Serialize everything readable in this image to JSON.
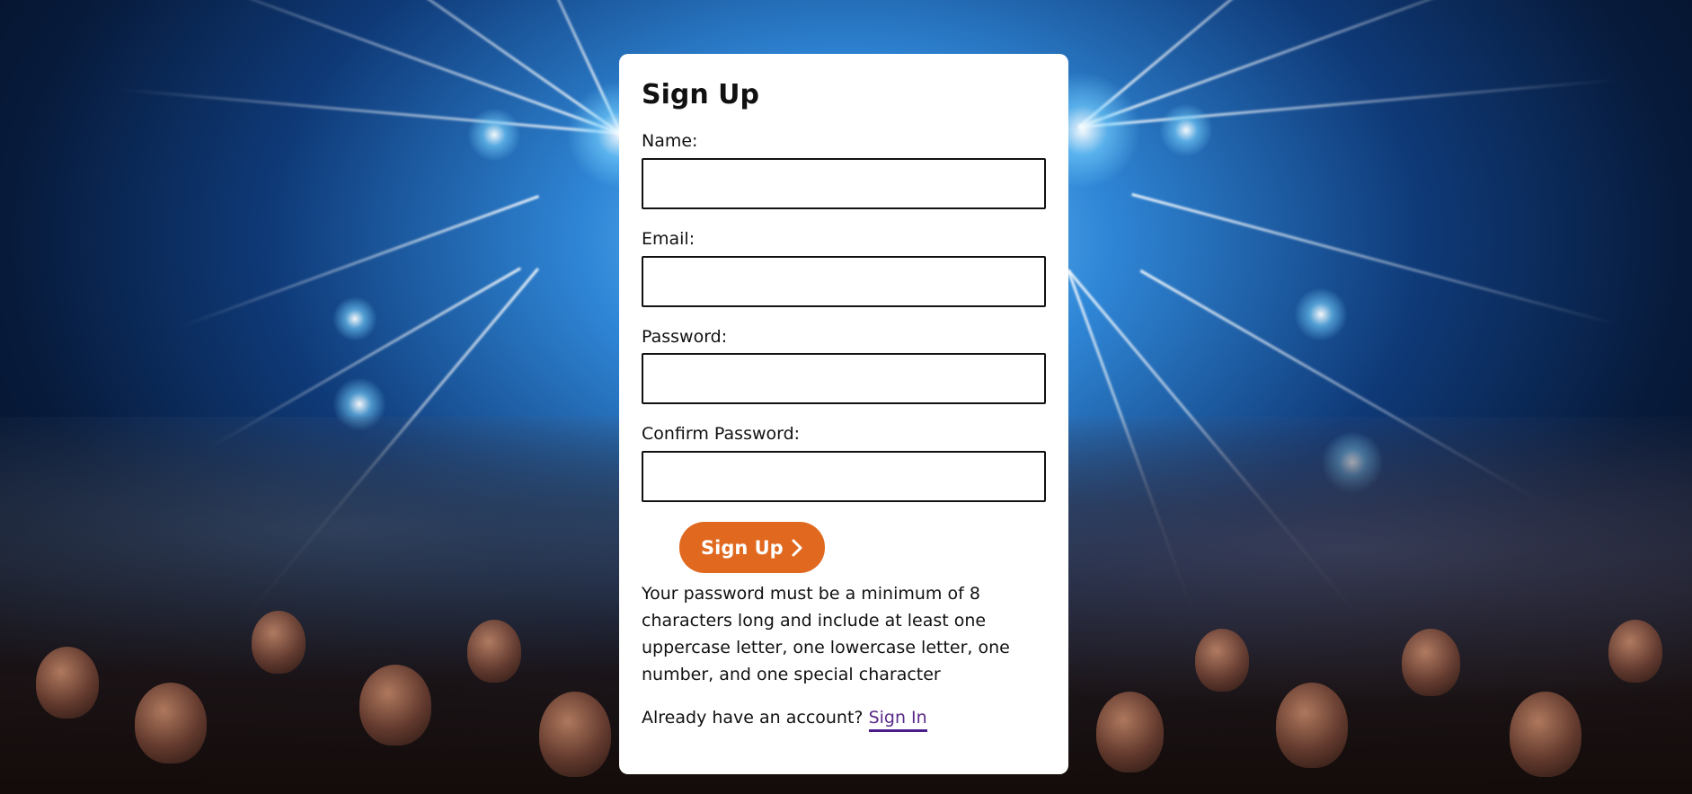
{
  "form": {
    "title": "Sign Up",
    "fields": [
      {
        "label": "Name:",
        "value": "",
        "placeholder": ""
      },
      {
        "label": "Email:",
        "value": "",
        "placeholder": ""
      },
      {
        "label": "Password:",
        "value": "",
        "placeholder": ""
      },
      {
        "label": "Confirm Password:",
        "value": "",
        "placeholder": ""
      }
    ],
    "submit_label": "Sign Up",
    "submit_icon": "chevron-right-icon",
    "password_hint": "Your password must be a minimum of 8 characters long and include at least one uppercase letter, one lowercase letter, one number, and one special character",
    "signin_prompt": "Already have an account?",
    "signin_link": "Sign In"
  },
  "colors": {
    "button": "#e0691f",
    "link": "#5a2a8a",
    "card": "#ffffff"
  }
}
